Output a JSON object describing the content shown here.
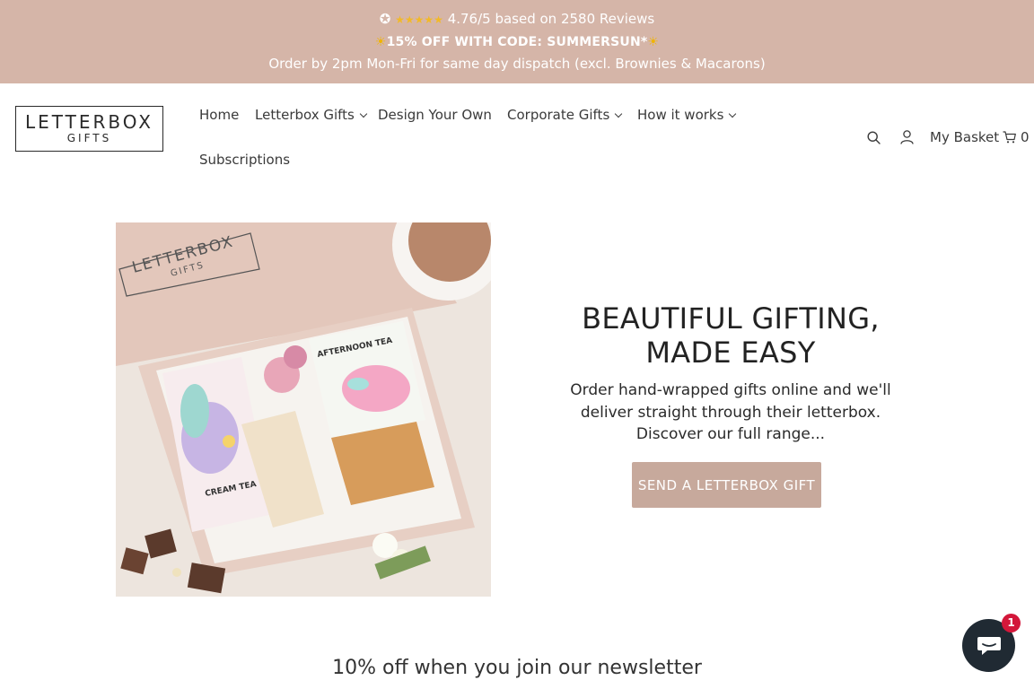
{
  "announcement": {
    "rating_icon": "star-circle-icon",
    "stars": "★★★★★",
    "rating_text": "4.76/5 based on 2580 Reviews",
    "promo_text": "15% OFF WITH CODE: SUMMERSUN*",
    "promo_icon": "sun-icon",
    "dispatch_text": "Order by 2pm Mon-Fri for same day dispatch (excl. Brownies & Macarons)",
    "background_color": "#d5b5a8"
  },
  "header": {
    "logo_main": "LETTERBOX",
    "logo_sub": "GIFTS",
    "nav": [
      {
        "label": "Home",
        "has_dropdown": false
      },
      {
        "label": "Letterbox Gifts",
        "has_dropdown": true
      },
      {
        "label": "Design Your Own",
        "has_dropdown": false
      },
      {
        "label": "Corporate Gifts",
        "has_dropdown": true
      },
      {
        "label": "How it works",
        "has_dropdown": true
      },
      {
        "label": "Subscriptions",
        "has_dropdown": false
      }
    ],
    "basket_label": "My Basket",
    "basket_count": "0"
  },
  "hero": {
    "image_alt": "Letterbox gift box with afternoon tea and cream tea treats",
    "image_box_logo_main": "LETTERBOX",
    "image_box_logo_sub": "GIFTS",
    "image_card1": "AFTERNOON TEA",
    "image_card2": "CREAM TEA",
    "title": "BEAUTIFUL GIFTING, MADE EASY",
    "text": "Order hand-wrapped gifts online and we'll deliver straight through their letterbox. Discover our full range...",
    "button_label": "SEND A LETTERBOX GIFT",
    "button_color": "#c7a99c"
  },
  "newsletter": {
    "heading": "10% off when you join our newsletter"
  },
  "chat": {
    "badge_count": "1",
    "icon": "chat-bubble-icon"
  }
}
